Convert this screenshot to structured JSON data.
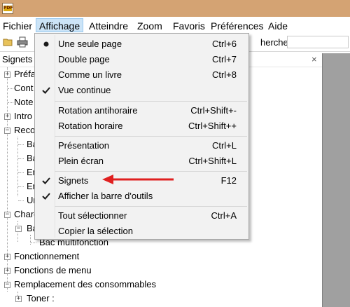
{
  "app": {
    "logo_text": "PDF"
  },
  "menubar": {
    "items": [
      "Fichier",
      "Affichage",
      "Atteindre",
      "Zoom",
      "Favoris",
      "Préférences",
      "Aide"
    ],
    "active": "Affichage"
  },
  "toolbar": {
    "search_label": "hercher :",
    "search_value": ""
  },
  "bookmarks_panel": {
    "title": "Signets",
    "close": "×",
    "items": [
      "Préfa",
      "Cont",
      "Note",
      "Intro",
      "Reco",
      "Ba",
      "Ba",
      "En",
      "En",
      "Un",
      "Charg",
      "Ba",
      "Bac multifonction",
      "Fonctionnement",
      "Fonctions de menu",
      "Remplacement des consommables",
      "Toner :"
    ]
  },
  "affichage_menu": {
    "groups": [
      [
        {
          "label": "Une seule page",
          "shortcut": "Ctrl+6",
          "mark": "bullet"
        },
        {
          "label": "Double page",
          "shortcut": "Ctrl+7",
          "mark": ""
        },
        {
          "label": "Comme un livre",
          "shortcut": "Ctrl+8",
          "mark": ""
        },
        {
          "label": "Vue continue",
          "shortcut": "",
          "mark": "check"
        }
      ],
      [
        {
          "label": "Rotation antihoraire",
          "shortcut": "Ctrl+Shift+-",
          "mark": ""
        },
        {
          "label": "Rotation horaire",
          "shortcut": "Ctrl+Shift++",
          "mark": ""
        }
      ],
      [
        {
          "label": "Présentation",
          "shortcut": "Ctrl+L",
          "mark": ""
        },
        {
          "label": "Plein écran",
          "shortcut": "Ctrl+Shift+L",
          "mark": ""
        }
      ],
      [
        {
          "label": "Signets",
          "shortcut": "F12",
          "mark": "check"
        },
        {
          "label": "Afficher la barre d'outils",
          "shortcut": "",
          "mark": "check"
        }
      ],
      [
        {
          "label": "Tout sélectionner",
          "shortcut": "Ctrl+A",
          "mark": ""
        },
        {
          "label": "Copier la sélection",
          "shortcut": "",
          "mark": ""
        }
      ]
    ]
  },
  "annotation": {
    "color": "#e02020"
  },
  "colors": {
    "titlebar": "#d4a373",
    "menu_highlight": "#cce4f7",
    "doc_background": "#a0a0a0"
  }
}
